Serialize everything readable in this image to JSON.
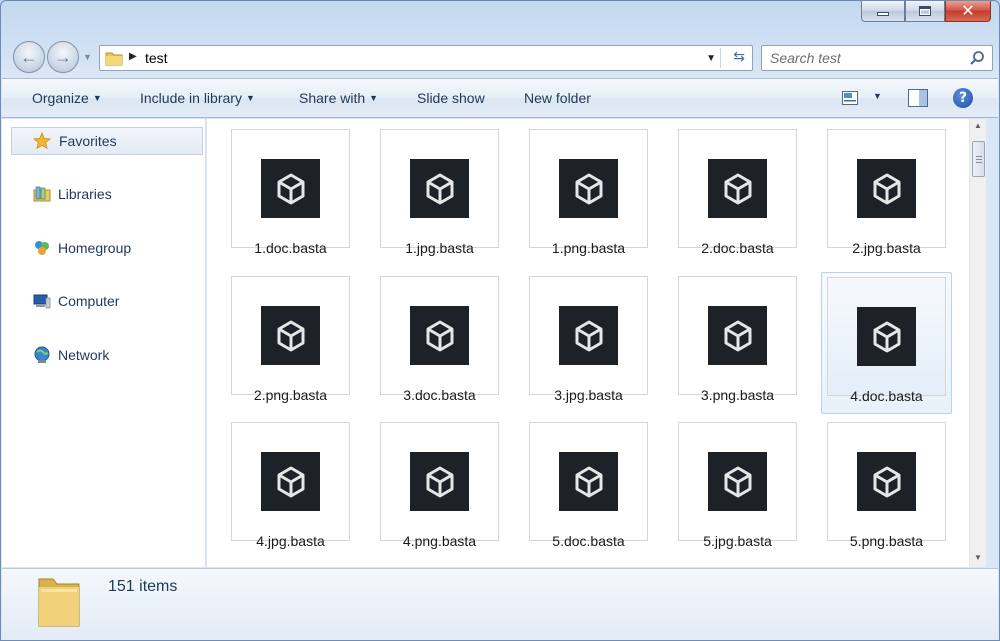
{
  "window": {
    "caption_buttons": {
      "minimize": "minimize-icon",
      "maximize": "maximize-icon",
      "close": "close-icon"
    }
  },
  "address_bar": {
    "breadcrumb_arrow": "▶",
    "current_folder": "test",
    "search_placeholder": "Search test"
  },
  "command_bar": {
    "organize": "Organize",
    "include_in_library": "Include in library",
    "share_with": "Share with",
    "slide_show": "Slide show",
    "new_folder": "New folder",
    "help": "?"
  },
  "nav_pane": {
    "items": [
      {
        "label": "Favorites",
        "icon": "star-icon"
      },
      {
        "label": "Libraries",
        "icon": "library-icon"
      },
      {
        "label": "Homegroup",
        "icon": "homegroup-icon"
      },
      {
        "label": "Computer",
        "icon": "computer-icon"
      },
      {
        "label": "Network",
        "icon": "network-icon"
      }
    ]
  },
  "files": [
    {
      "name": "1.doc.basta"
    },
    {
      "name": "1.jpg.basta"
    },
    {
      "name": "1.png.basta"
    },
    {
      "name": "2.doc.basta"
    },
    {
      "name": "2.jpg.basta"
    },
    {
      "name": "2.png.basta"
    },
    {
      "name": "3.doc.basta"
    },
    {
      "name": "3.jpg.basta"
    },
    {
      "name": "3.png.basta"
    },
    {
      "name": "4.doc.basta",
      "selected": true
    },
    {
      "name": "4.jpg.basta"
    },
    {
      "name": "4.png.basta"
    },
    {
      "name": "5.doc.basta"
    },
    {
      "name": "5.jpg.basta"
    },
    {
      "name": "5.png.basta"
    }
  ],
  "details_pane": {
    "item_count": "151 items"
  },
  "colors": {
    "accent_text": "#1e395b",
    "thumbnail_bg": "#1c2227",
    "close_button": "#c7432f"
  }
}
